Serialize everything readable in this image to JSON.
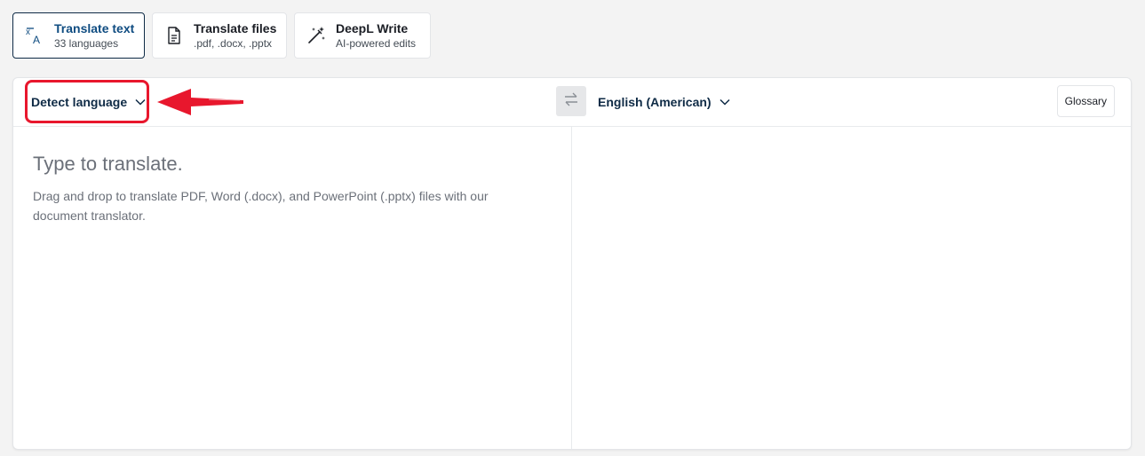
{
  "modes": [
    {
      "title": "Translate text",
      "subtitle": "33 languages",
      "icon": "translate-icon",
      "active": true
    },
    {
      "title": "Translate files",
      "subtitle": ".pdf, .docx, .pptx",
      "icon": "document-icon",
      "active": false
    },
    {
      "title": "DeepL Write",
      "subtitle": "AI-powered edits",
      "icon": "magic-wand-icon",
      "active": false
    }
  ],
  "translator": {
    "source_language": "Detect language",
    "target_language": "English (American)",
    "glossary_label": "Glossary",
    "source_placeholder": "Type to translate.",
    "drag_hint": "Drag and drop to translate PDF, Word (.docx), and PowerPoint (.pptx) files with our document translator."
  },
  "annotation": {
    "highlight_color": "#e8172d"
  },
  "colors": {
    "active_tab_text": "#0f4c81",
    "navy": "#0f2b46"
  }
}
